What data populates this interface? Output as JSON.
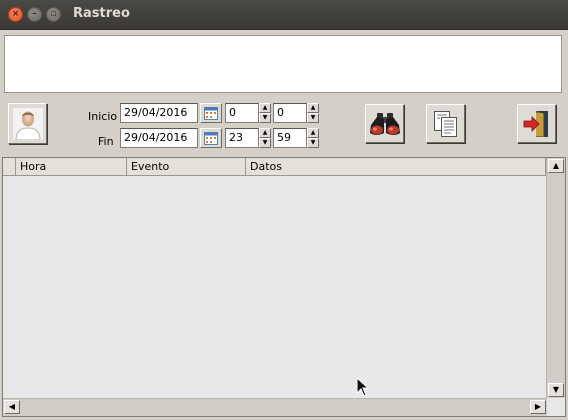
{
  "window": {
    "title": "Rastreo"
  },
  "filters": {
    "inicio_label": "Inicio",
    "fin_label": "Fin",
    "inicio_date": "29/04/2016",
    "inicio_hour": "0",
    "inicio_minute": "0",
    "fin_date": "29/04/2016",
    "fin_hour": "23",
    "fin_minute": "59"
  },
  "table": {
    "columns": [
      "Hora",
      "Evento",
      "Datos"
    ]
  },
  "icons": {
    "user": "user-icon",
    "search": "binoculars-icon",
    "copy": "copy-icon",
    "exit": "exit-icon",
    "calendar": "calendar-icon"
  }
}
